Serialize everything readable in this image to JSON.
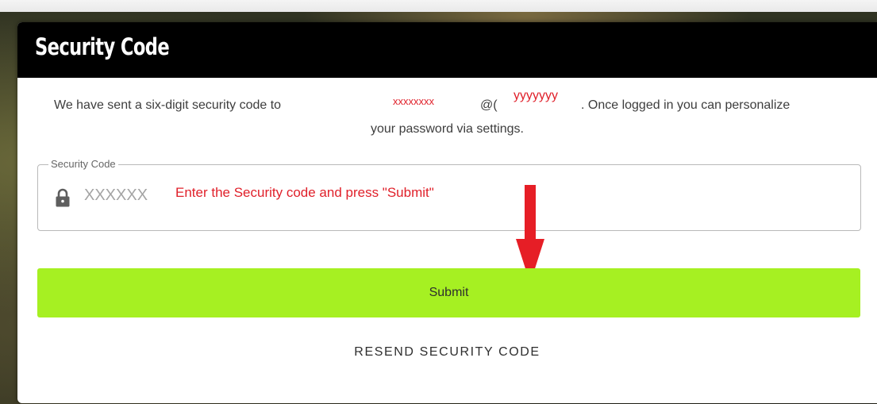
{
  "modal": {
    "title": "Security Code",
    "message": {
      "prefix": "We have sent a six-digit security code to",
      "user_redacted": "xxxxxxxx",
      "at": "@(",
      "domain_redacted": "yyyyyyy",
      "suffix": ". Once logged in you can personalize",
      "line2": "your password via settings."
    },
    "field": {
      "legend": "Security Code",
      "placeholder": "XXXXXX",
      "value": "",
      "icon": "lock-icon"
    },
    "annotation": {
      "hint": "Enter the Security code and press \"Submit\"",
      "color": "#e0202a",
      "arrow_icon": "down-arrow-icon"
    },
    "submit_label": "Submit",
    "resend_label": "RESEND SECURITY CODE"
  },
  "colors": {
    "header_bg": "#000000",
    "submit_bg": "#a6f022",
    "annotation": "#e0202a"
  }
}
